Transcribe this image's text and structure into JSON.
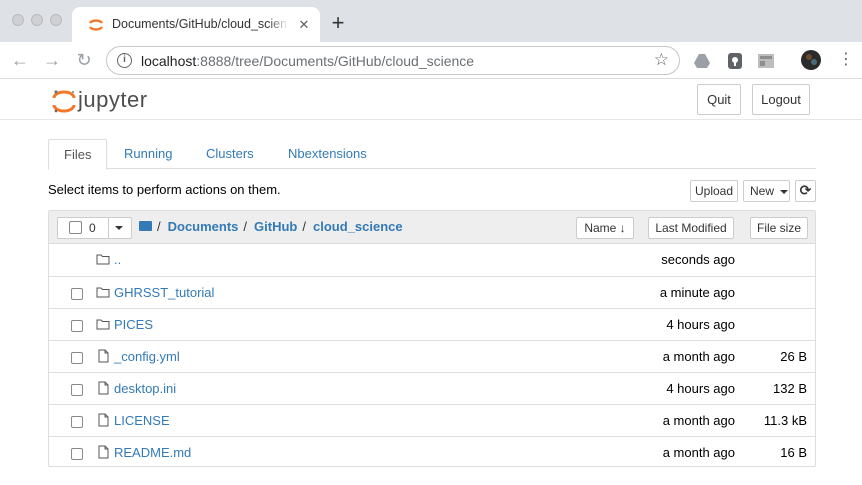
{
  "browser": {
    "tab_title": "Documents/GitHub/cloud_science",
    "new_tab_icon": "+",
    "url_host": "localhost",
    "url_path": ":8888/tree/Documents/GitHub/cloud_science"
  },
  "header": {
    "logo_text": "jupyter",
    "quit_label": "Quit",
    "logout_label": "Logout"
  },
  "tabs": [
    {
      "label": "Files"
    },
    {
      "label": "Running"
    },
    {
      "label": "Clusters"
    },
    {
      "label": "Nbextensions"
    }
  ],
  "toolbar": {
    "hint": "Select items to perform actions on them.",
    "upload_label": "Upload",
    "new_label": "New",
    "refresh_icon": "⟳"
  },
  "list_header": {
    "selected_count": "0",
    "breadcrumb": [
      "Documents",
      "GitHub",
      "cloud_science"
    ],
    "root_slash": "/",
    "sort_name_label": "Name",
    "sort_arrow": "↓",
    "last_modified_label": "Last Modified",
    "file_size_label": "File size"
  },
  "rows": [
    {
      "type": "folder",
      "name": "..",
      "modified": "seconds ago",
      "size": "",
      "checkbox": false
    },
    {
      "type": "folder",
      "name": "GHRSST_tutorial",
      "modified": "a minute ago",
      "size": "",
      "checkbox": true
    },
    {
      "type": "folder",
      "name": "PICES",
      "modified": "4 hours ago",
      "size": "",
      "checkbox": true
    },
    {
      "type": "file",
      "name": "_config.yml",
      "modified": "a month ago",
      "size": "26 B",
      "checkbox": true
    },
    {
      "type": "file",
      "name": "desktop.ini",
      "modified": "4 hours ago",
      "size": "132 B",
      "checkbox": true
    },
    {
      "type": "file",
      "name": "LICENSE",
      "modified": "a month ago",
      "size": "11.3 kB",
      "checkbox": true
    },
    {
      "type": "file",
      "name": "README.md",
      "modified": "a month ago",
      "size": "16 B",
      "checkbox": true
    }
  ],
  "colors": {
    "link": "#337ab7",
    "jupyter_orange": "#f37726"
  }
}
